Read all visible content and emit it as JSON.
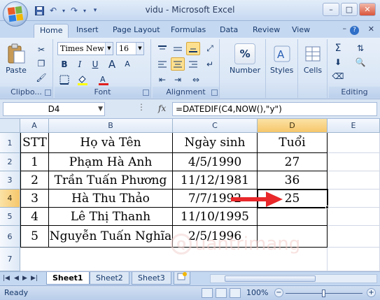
{
  "window": {
    "title": "vidu - Microsoft Excel",
    "minimize": "–",
    "maximize": "□",
    "close": "✕"
  },
  "quick_access": [
    {
      "icon": "save-icon",
      "glyph": "💾"
    },
    {
      "icon": "undo-icon",
      "glyph": "↶"
    },
    {
      "icon": "redo-icon",
      "glyph": "↷"
    },
    {
      "icon": "customize-qat-icon",
      "glyph": "▾"
    }
  ],
  "tabs": [
    "Home",
    "Insert",
    "Page Layout",
    "Formulas",
    "Data",
    "Review",
    "View"
  ],
  "active_tab": "Home",
  "ribbon": {
    "clipboard": {
      "label": "Clipbo...",
      "paste": "Paste"
    },
    "font": {
      "label": "Font",
      "font_name": "Times New Ro",
      "font_size": "16",
      "bold": "B",
      "italic": "I",
      "underline": "U"
    },
    "alignment": {
      "label": "Alignment"
    },
    "number": {
      "label": "Number",
      "percent": "%"
    },
    "styles": {
      "label": "Styles"
    },
    "cells": {
      "label": "Cells"
    },
    "editing": {
      "label": "Editing",
      "sum": "Σ"
    }
  },
  "formula_bar": {
    "name_box": "D4",
    "fx": "fx",
    "formula": "=DATEDIF(C4,NOW(),\"y\")"
  },
  "columns": [
    "A",
    "B",
    "C",
    "D",
    "E"
  ],
  "selected_column": "D",
  "rows": [
    "1",
    "2",
    "3",
    "4",
    "5",
    "6",
    "7"
  ],
  "selected_row": "4",
  "table": {
    "headers": [
      "STT",
      "Họ và Tên",
      "Ngày sinh",
      "Tuổi"
    ],
    "rows": [
      [
        "1",
        "Phạm Hà Anh",
        "4/5/1990",
        "27"
      ],
      [
        "2",
        "Trần Tuấn Phương",
        "11/12/1981",
        "36"
      ],
      [
        "3",
        "Hà Thu Thảo",
        "7/7/1992",
        "25"
      ],
      [
        "4",
        "Lê Thị Thanh",
        "11/10/1995",
        ""
      ],
      [
        "5",
        "Nguyễn Tuấn Nghĩa",
        "2/5/1996",
        ""
      ]
    ]
  },
  "annotation": {
    "arrow_color": "#e8282a"
  },
  "watermark": {
    "text": "uantrimang",
    "logo_letter": "Q"
  },
  "sheets": [
    "Sheet1",
    "Sheet2",
    "Sheet3"
  ],
  "active_sheet": "Sheet1",
  "status": {
    "text": "Ready",
    "zoom": "100%",
    "zoom_level_percent": 100
  },
  "colors": {
    "selection_header": "#f6c66a",
    "ribbon_bg": "#dbe7f6",
    "accent": "#15386b"
  }
}
